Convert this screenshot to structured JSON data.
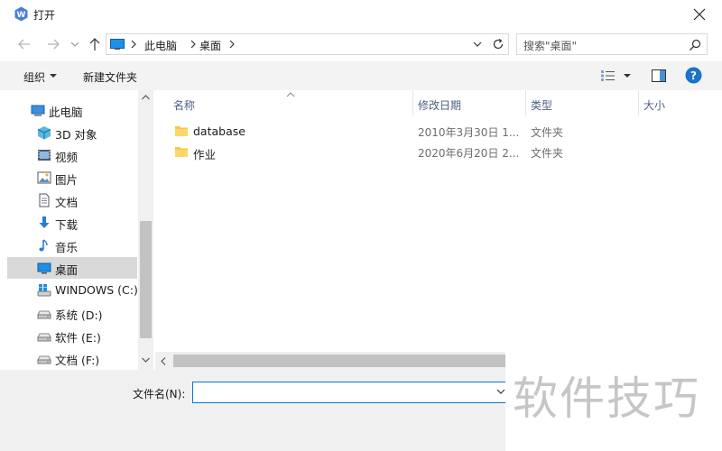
{
  "window": {
    "title": "打开"
  },
  "address": {
    "segments": [
      "此电脑",
      "桌面"
    ]
  },
  "search": {
    "text": "搜索\"桌面\""
  },
  "toolbar": {
    "organize": "组织",
    "new_folder": "新建文件夹"
  },
  "nav": {
    "items": [
      {
        "label": "此电脑",
        "icon": "computer-icon",
        "selected": false
      },
      {
        "label": "3D 对象",
        "icon": "cube-icon",
        "selected": false
      },
      {
        "label": "视频",
        "icon": "video-icon",
        "selected": false
      },
      {
        "label": "图片",
        "icon": "picture-icon",
        "selected": false
      },
      {
        "label": "文档",
        "icon": "document-icon",
        "selected": false
      },
      {
        "label": "下载",
        "icon": "download-icon",
        "selected": false
      },
      {
        "label": "音乐",
        "icon": "music-icon",
        "selected": false
      },
      {
        "label": "桌面",
        "icon": "desktop-icon",
        "selected": true
      },
      {
        "label": "WINDOWS (C:)",
        "icon": "windows-drive-icon",
        "selected": false
      },
      {
        "label": "系统 (D:)",
        "icon": "drive-icon",
        "selected": false
      },
      {
        "label": "软件 (E:)",
        "icon": "drive-icon",
        "selected": false
      },
      {
        "label": "文档 (F:)",
        "icon": "drive-icon",
        "selected": false
      }
    ]
  },
  "columns": {
    "name": "名称",
    "modified": "修改日期",
    "type": "类型",
    "size": "大小"
  },
  "files": [
    {
      "name": "database",
      "modified": "2010年3月30日 1...",
      "type": "文件夹"
    },
    {
      "name": "作业",
      "modified": "2020年6月20日 2...",
      "type": "文件夹"
    }
  ],
  "bottom": {
    "filename_label": "文件名(N):",
    "filename_value": ""
  },
  "watermark": {
    "text": "软件技巧"
  },
  "colors": {
    "accent": "#0078d7",
    "folder": "#f8c846",
    "help": "#1a73c8"
  }
}
